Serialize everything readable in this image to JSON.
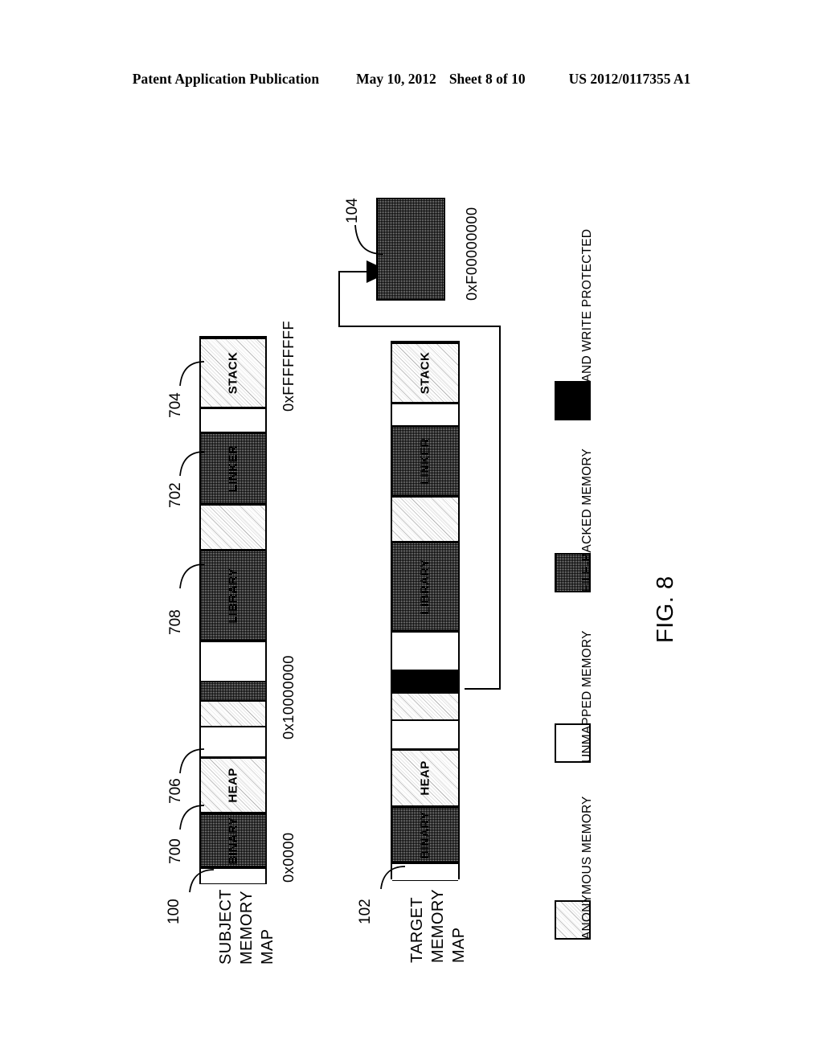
{
  "header": {
    "publication": "Patent Application Publication",
    "date": "May 10, 2012",
    "sheet": "Sheet 8 of 10",
    "patent_number": "US 2012/0117355 A1"
  },
  "figure": {
    "caption": "FIG. 8"
  },
  "subject_map": {
    "ref": "100",
    "title_line1": "SUBJECT",
    "title_line2": "MEMORY",
    "title_line3": "MAP",
    "addresses": {
      "low": "0x0000",
      "mid": "0x10000000",
      "high": "0xFFFFFFFF"
    },
    "segment_refs": {
      "binary": "700",
      "linker": "702",
      "stack": "704",
      "heap": "706",
      "library": "708"
    },
    "segments": [
      {
        "label": "",
        "fill": "unmapped",
        "ref": ""
      },
      {
        "label": "BINARY",
        "fill": "file",
        "ref": "700"
      },
      {
        "label": "HEAP",
        "fill": "anon",
        "ref": "706"
      },
      {
        "label": "",
        "fill": "unmapped",
        "ref": ""
      },
      {
        "label": "",
        "fill": "anon",
        "ref": ""
      },
      {
        "label": "",
        "fill": "file",
        "ref": ""
      },
      {
        "label": "",
        "fill": "unmapped",
        "ref": ""
      },
      {
        "label": "LIBRARY",
        "fill": "file",
        "ref": "708"
      },
      {
        "label": "",
        "fill": "anon",
        "ref": ""
      },
      {
        "label": "LINKER",
        "fill": "file",
        "ref": "702"
      },
      {
        "label": "",
        "fill": "unmapped",
        "ref": ""
      },
      {
        "label": "STACK",
        "fill": "anon",
        "ref": "704"
      }
    ]
  },
  "target_map": {
    "ref": "102",
    "title_line1": "TARGET",
    "title_line2": "MEMORY",
    "title_line3": "MAP",
    "segments": [
      {
        "label": "",
        "fill": "unmapped"
      },
      {
        "label": "BINARY",
        "fill": "file"
      },
      {
        "label": "HEAP",
        "fill": "anon"
      },
      {
        "label": "",
        "fill": "unmapped"
      },
      {
        "label": "",
        "fill": "anon"
      },
      {
        "label": "",
        "fill": "protected"
      },
      {
        "label": "",
        "fill": "unmapped"
      },
      {
        "label": "LIBRARY",
        "fill": "file"
      },
      {
        "label": "",
        "fill": "anon"
      },
      {
        "label": "LINKER",
        "fill": "file"
      },
      {
        "label": "",
        "fill": "unmapped"
      },
      {
        "label": "STACK",
        "fill": "anon"
      }
    ]
  },
  "mapped_block": {
    "ref": "104",
    "address": "0xF00000000",
    "fill": "file"
  },
  "legend": {
    "items": [
      {
        "label": "ANONYMOUS MEMORY",
        "fill": "anon"
      },
      {
        "label": "UNMAPPED MEMORY",
        "fill": "unmapped"
      },
      {
        "label": "FILE-BACKED MEMORY",
        "fill": "file"
      },
      {
        "label": "READ AND WRITE PROTECTED",
        "fill": "protected"
      }
    ]
  }
}
